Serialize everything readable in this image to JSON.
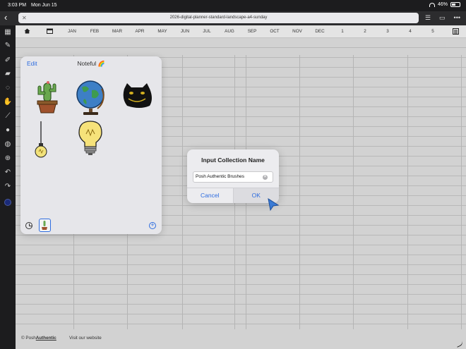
{
  "status_bar": {
    "time": "3:03 PM",
    "date": "Mon Jun 15",
    "battery": "46%"
  },
  "browser": {
    "url_title": "2026-digital-planner-standard-landscape-a4-sunday"
  },
  "planner": {
    "tabs": [
      "JAN",
      "FEB",
      "MAR",
      "APR",
      "MAY",
      "JUN",
      "JUL",
      "AUG",
      "SEP",
      "OCT",
      "NOV",
      "DEC",
      "1",
      "2",
      "3",
      "4",
      "5"
    ],
    "footer": {
      "brand_prefix": "© Posh",
      "brand_bold": "Authentic",
      "link": "Visit our website"
    }
  },
  "sticker_panel": {
    "edit_label": "Edit",
    "title": "Noteful",
    "title_emoji": "🌈",
    "stickers": [
      "cactus",
      "globe",
      "black-cat",
      "hanging-bulb",
      "lightbulb"
    ]
  },
  "dialog": {
    "title": "Input Collection Name",
    "input_value": "Posh Authentic Brushes",
    "cancel_label": "Cancel",
    "ok_label": "OK"
  },
  "colors": {
    "accent": "#2d6cdf",
    "toolbar_bg": "#1c1c1e",
    "page_bg": "#d2d2d2"
  }
}
